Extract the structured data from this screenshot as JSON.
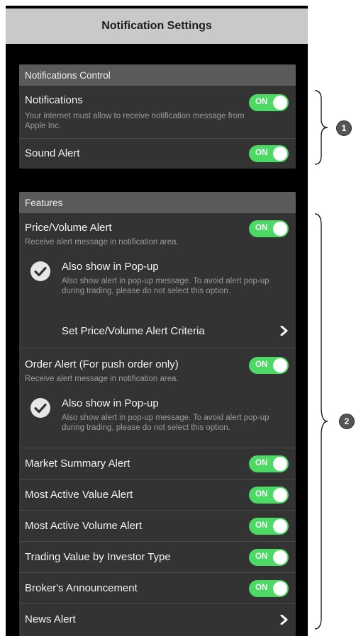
{
  "screen": {
    "title": "Notification Settings"
  },
  "notifications_control": {
    "header": "Notifications Control",
    "notifications": {
      "label": "Notifications",
      "description": "Your internet must allow to receive notification message from Apple Inc.",
      "toggle": "ON"
    },
    "sound_alert": {
      "label": "Sound Alert",
      "toggle": "ON"
    }
  },
  "features": {
    "header": "Features",
    "price_volume_alert": {
      "label": "Price/Volume Alert",
      "description": "Receive alert message in notification area.",
      "toggle": "ON",
      "popup_label": "Also show in Pop-up",
      "popup_description": "Also show alert in pop-up message. To avoid alert pop-up during trading, please do not select this option.",
      "criteria_label": "Set Price/Volume Alert Criteria"
    },
    "order_alert": {
      "label": "Order Alert (For push order only)",
      "description": "Receive alert message in notification area.",
      "toggle": "ON",
      "popup_label": "Also show in Pop-up",
      "popup_description": "Also show alert in pop-up message. To avoid alert pop-up during trading, please do not select this option."
    },
    "market_summary_alert": {
      "label": "Market Summary Alert",
      "toggle": "ON"
    },
    "most_active_value_alert": {
      "label": "Most Active Value Alert",
      "toggle": "ON"
    },
    "most_active_volume_alert": {
      "label": "Most Active Volume Alert",
      "toggle": "ON"
    },
    "trading_value_by_investor_type": {
      "label": "Trading Value by Investor Type",
      "toggle": "ON"
    },
    "brokers_announcement": {
      "label": "Broker's Announcement",
      "toggle": "ON"
    },
    "news_alert": {
      "label": "News Alert"
    }
  },
  "annotations": {
    "badge_1": "1",
    "badge_2": "2"
  },
  "colors": {
    "toggle_on": "#4cd964",
    "section_bg": "#333333",
    "header_bg": "#5a5a5a",
    "navbar_bg": "#c9c9c9"
  }
}
